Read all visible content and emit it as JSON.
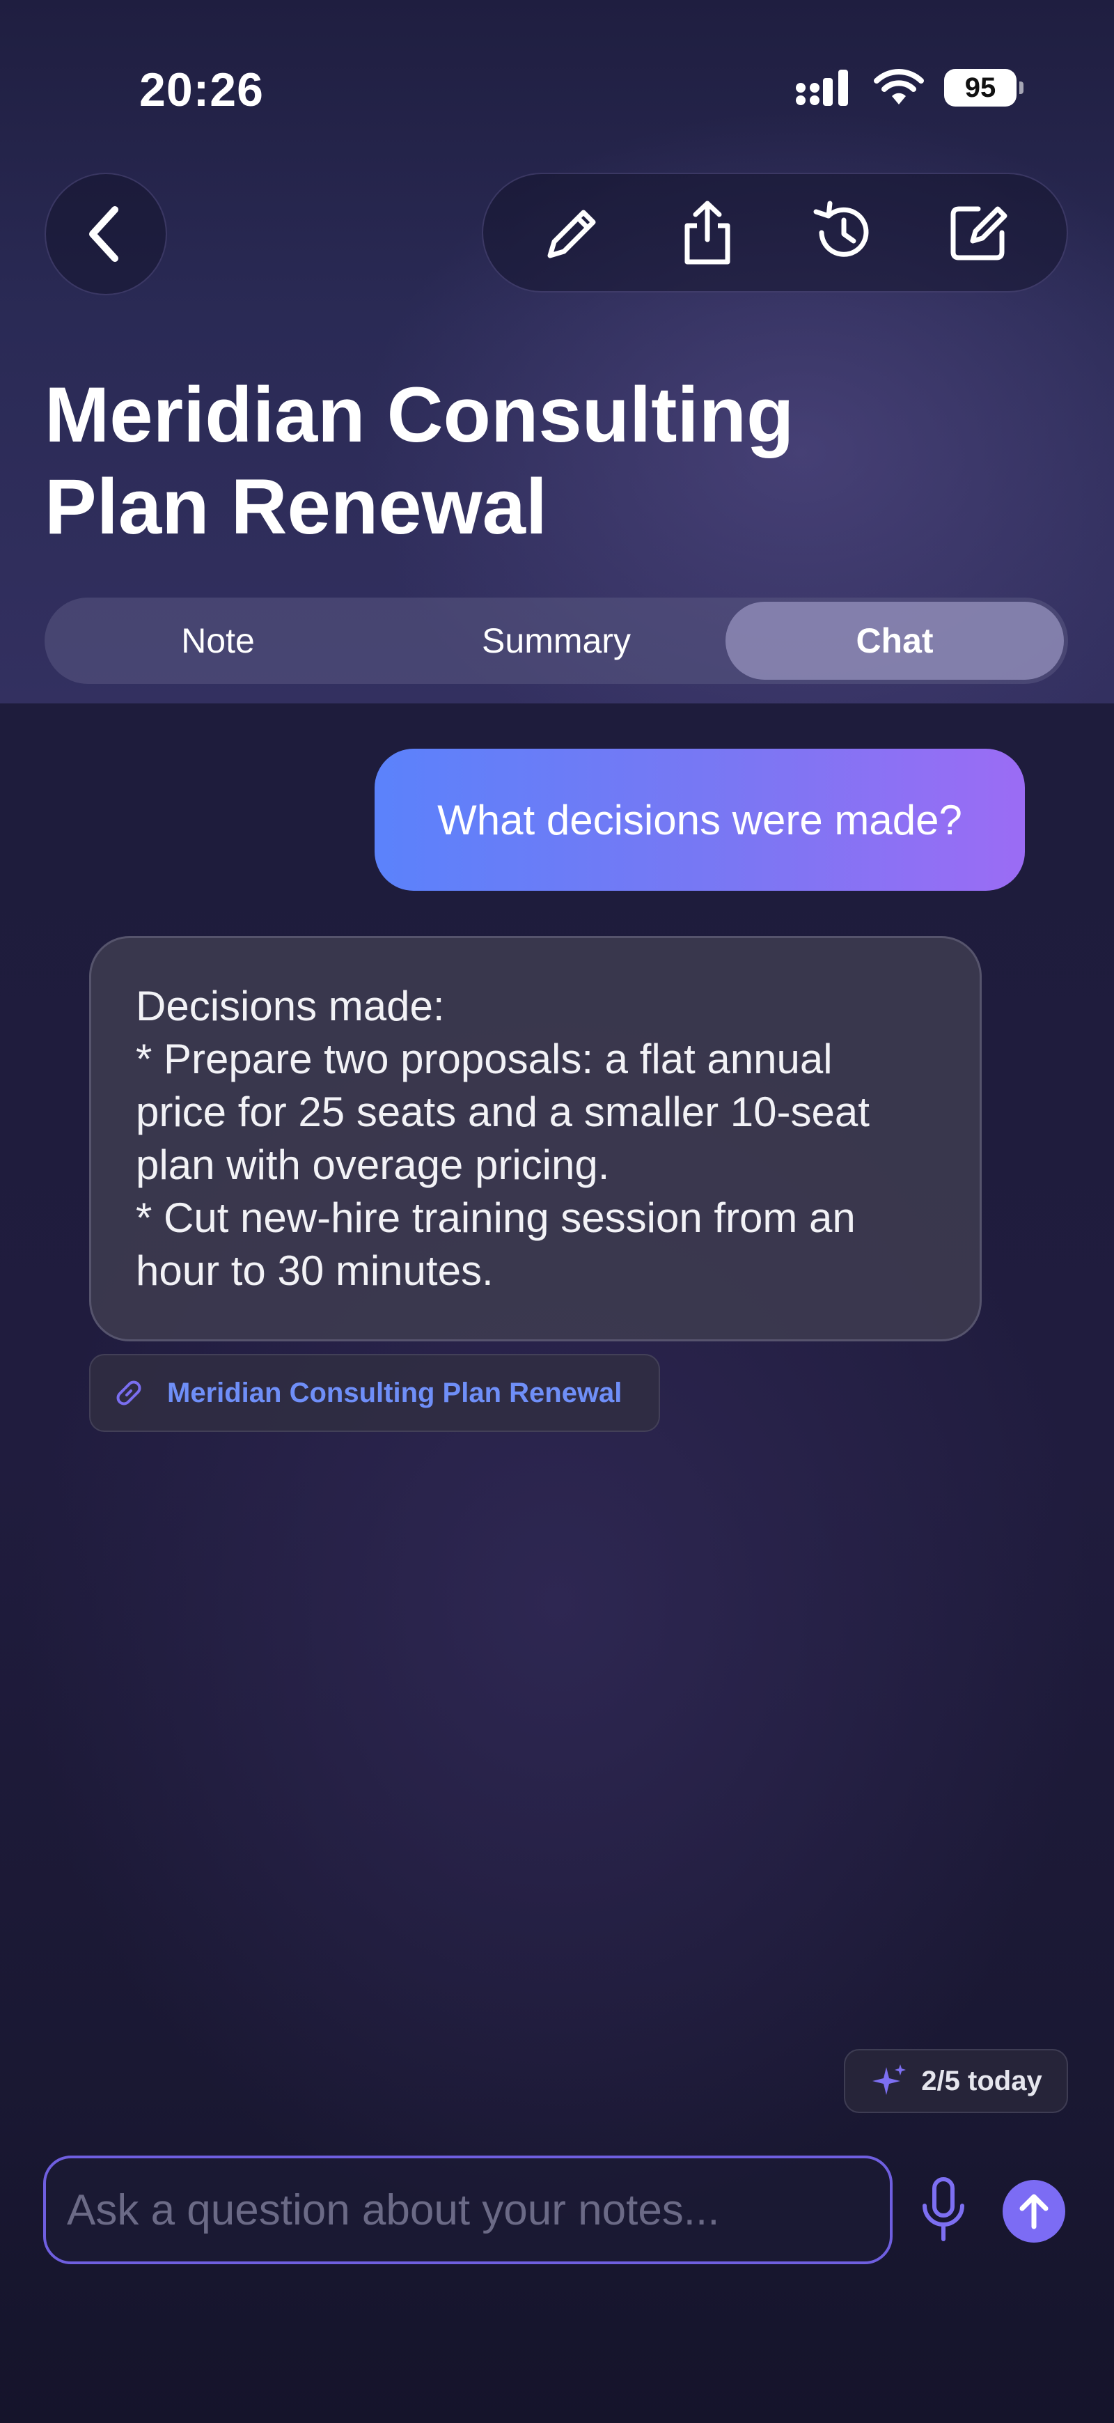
{
  "status_bar": {
    "time": "20:26",
    "battery_level": "95",
    "icons": [
      "signal-icon",
      "wifi-icon",
      "battery-icon"
    ]
  },
  "header": {
    "back_icon": "chevron-left-icon",
    "toolbar_icons": [
      "pencil-icon",
      "share-icon",
      "history-icon",
      "compose-icon"
    ],
    "title_line1": "Meridian Consulting",
    "title_line2": "Plan Renewal"
  },
  "tabs": [
    {
      "label": "Note",
      "active": false
    },
    {
      "label": "Summary",
      "active": false
    },
    {
      "label": "Chat",
      "active": true
    }
  ],
  "chat": {
    "user_message": "What decisions were made?",
    "assistant_lines": [
      "Decisions made:",
      "* Prepare two proposals: a flat annual",
      "price for 25 seats and a smaller 10-seat",
      "plan with overage pricing.",
      "* Cut new-hire training session from an",
      "hour to 30 minutes."
    ],
    "source_icon": "link-icon",
    "source_label": "Meridian Consulting Plan Renewal"
  },
  "quota": {
    "icon": "sparkle-icon",
    "label": "2/5 today"
  },
  "composer": {
    "placeholder": "Ask a question about your notes...",
    "value": "",
    "mic_icon": "microphone-icon",
    "send_icon": "arrow-up-icon"
  },
  "colors": {
    "accent": "#7c6cf4",
    "user_bubble_start": "#5b82fb",
    "user_bubble_end": "#9b6cf4",
    "link": "#6f8ff8"
  }
}
